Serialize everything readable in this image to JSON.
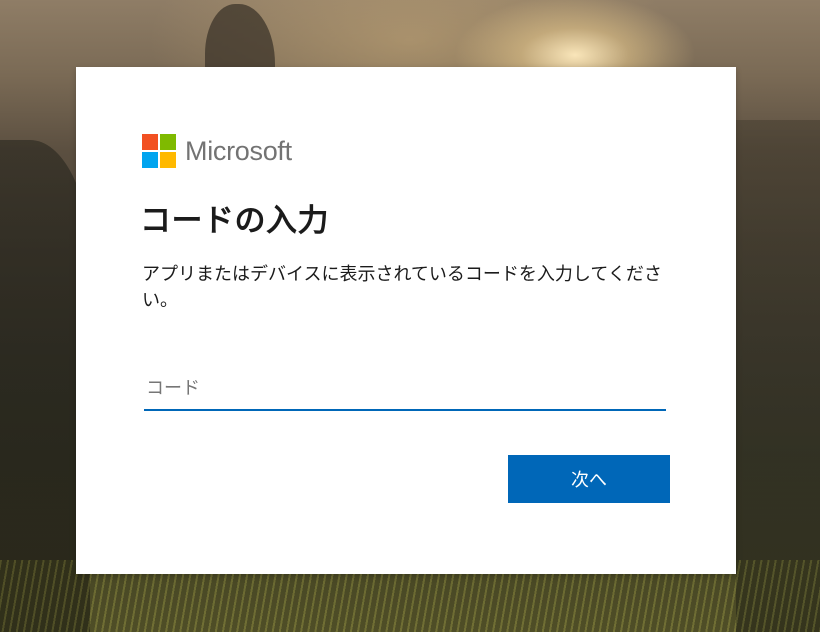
{
  "brand": {
    "name": "Microsoft",
    "logo_colors": [
      "#f25022",
      "#7fba00",
      "#00a4ef",
      "#ffb900"
    ]
  },
  "page": {
    "title": "コードの入力",
    "description": "アプリまたはデバイスに表示されているコードを入力してください。"
  },
  "code_input": {
    "placeholder": "コード",
    "value": ""
  },
  "actions": {
    "next_label": "次へ"
  },
  "colors": {
    "accent": "#0067b8"
  }
}
